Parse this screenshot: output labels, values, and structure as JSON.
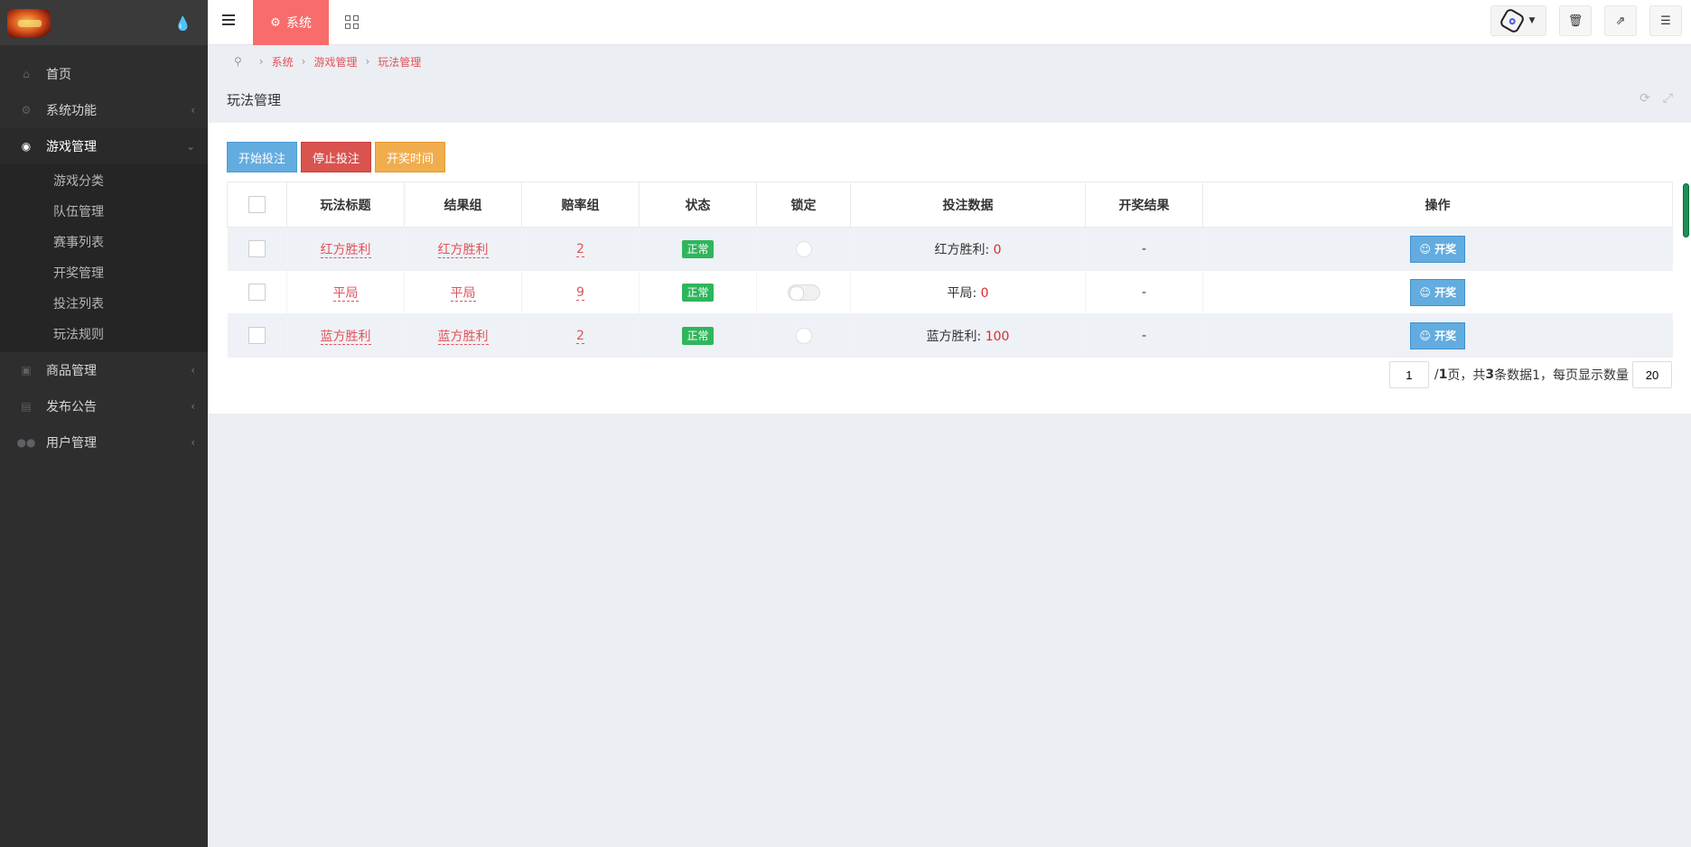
{
  "sidebar": {
    "items": [
      {
        "label": "首页",
        "icon": "home-icon"
      },
      {
        "label": "系统功能",
        "icon": "gear-icon",
        "caret": "‹"
      },
      {
        "label": "游戏管理",
        "icon": "gamepad-icon",
        "caret": "⌄"
      },
      {
        "label": "商品管理",
        "icon": "bag-icon",
        "caret": "‹"
      },
      {
        "label": "发布公告",
        "icon": "newspaper-icon",
        "caret": "‹"
      },
      {
        "label": "用户管理",
        "icon": "users-icon",
        "caret": "‹"
      }
    ],
    "subitems": [
      "游戏分类",
      "队伍管理",
      "赛事列表",
      "开奖管理",
      "投注列表",
      "玩法规则"
    ]
  },
  "topbar": {
    "tab_label": "系统"
  },
  "breadcrumb": [
    "系统",
    "游戏管理",
    "玩法管理"
  ],
  "panel": {
    "title": "玩法管理"
  },
  "toolbar": {
    "start_label": "开始投注",
    "stop_label": "停止投注",
    "draw_time_label": "开奖时间"
  },
  "table": {
    "headers": [
      "玩法标题",
      "结果组",
      "赔率组",
      "状态",
      "锁定",
      "投注数据",
      "开奖结果",
      "操作"
    ],
    "rows": [
      {
        "title": "红方胜利",
        "group": "红方胜利",
        "odds": "2",
        "status": "正常",
        "bet_label": "红方胜利: ",
        "bet_value": "0",
        "result": "-",
        "action": "☺ 开奖"
      },
      {
        "title": "平局",
        "group": "平局",
        "odds": "9",
        "status": "正常",
        "bet_label": "平局: ",
        "bet_value": "0",
        "result": "-",
        "action": "☺ 开奖"
      },
      {
        "title": "蓝方胜利",
        "group": "蓝方胜利",
        "odds": "2",
        "status": "正常",
        "bet_label": "蓝方胜利: ",
        "bet_value": "100",
        "result": "-",
        "action": "☺ 开奖"
      }
    ]
  },
  "pager": {
    "page": "1",
    "total_pages": "1",
    "text_mid": " 页，共 ",
    "total": "3",
    "text_end": " 条数据1，每页显示数量",
    "per_page": "20"
  },
  "colors": {
    "sidebar_bg": "#2e2e2f",
    "accent_tab": "#f86c6b",
    "link": "#e0535a",
    "status_green": "#2fb55c",
    "primary": "#63acdf",
    "danger": "#d9534f",
    "warning": "#f0ad4e"
  }
}
